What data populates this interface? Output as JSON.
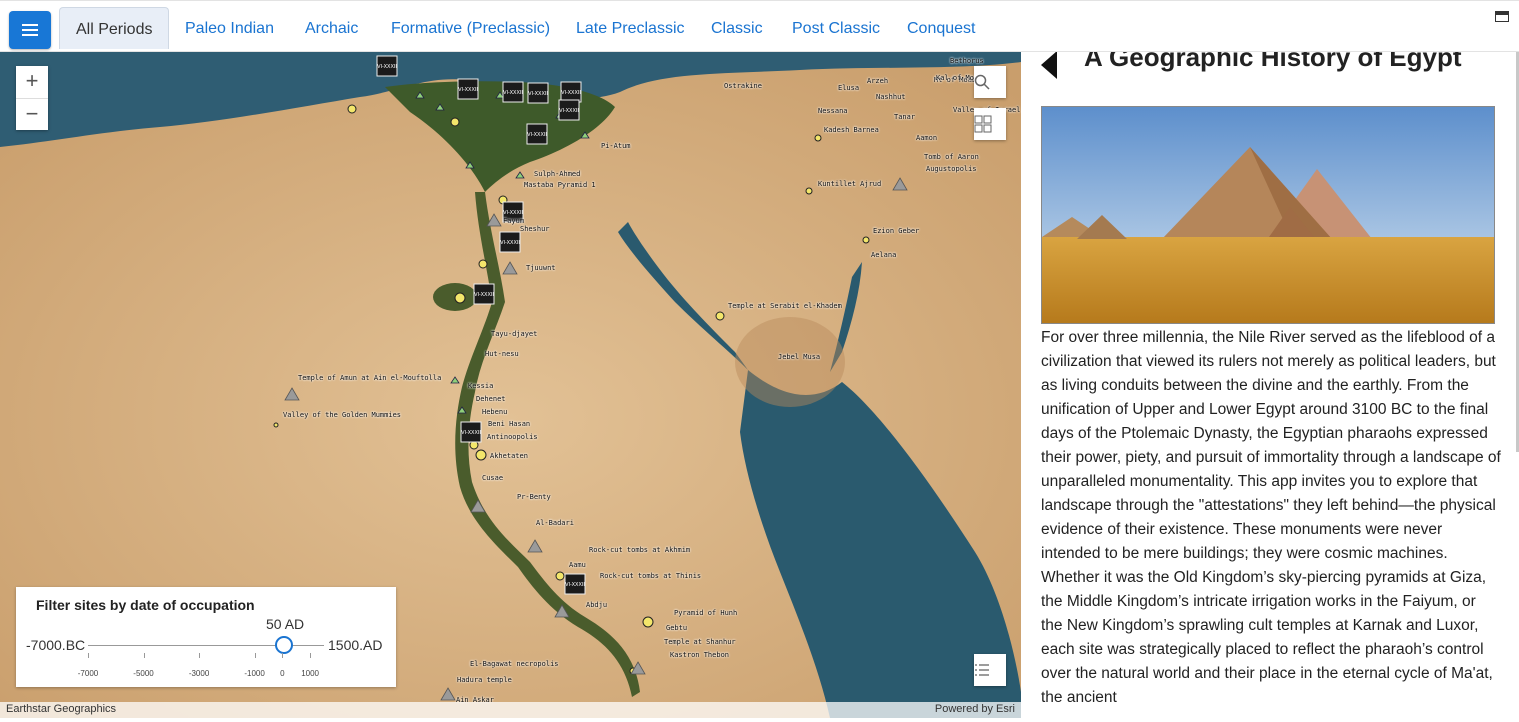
{
  "nav": {
    "tabs": [
      "All Periods",
      "Paleo Indian",
      "Archaic",
      "Formative (Preclassic)",
      "Late Preclassic",
      "Classic",
      "Post Classic",
      "Conquest"
    ],
    "active_tab": "All Periods"
  },
  "map": {
    "labels": [
      "Bethorus",
      "Arzeh",
      "Mt of Moab",
      "Ostrakine",
      "Elusa",
      "Nashhut",
      "Kal of Moab",
      "Nessana",
      "Valley of Israel",
      "Tanar",
      "Kadesh Barnea",
      "Aamon",
      "Tomb of Aaron",
      "Augustopolis",
      "Kuntillet Ajrud",
      "Ezion Geber",
      "Aelana",
      "Temple at Serabit el-Khadem",
      "Jebel Musa",
      "Pi-Atum",
      "Sulph-Ahmed",
      "Mastaba Pyramid 1",
      "Tjuuwnt",
      "Fayum",
      "Sheshur",
      "Tayu-djayet",
      "Hut-nesu",
      "Kessia",
      "Dehenet",
      "Hebenu",
      "Beni Hasan",
      "Antinoopolis",
      "Akhetaten",
      "Cusae",
      "Pr-Benty",
      "Al-Badari",
      "Rock-cut tombs at Akhmim",
      "Rock-cut tombs at Thinis",
      "Aamu",
      "Abdju",
      "Pyramid of Hunh",
      "Gebtu",
      "Temple at Shanhur",
      "Kastron Thebon",
      "Temple of Amun at Ain el-Mouftolla",
      "Valley of the Golden Mummies",
      "El-Bagawat necropolis",
      "Hadura temple",
      "Ain Askar"
    ],
    "dynasty_badges": [
      "VI-XXXII",
      "VI-XXXII",
      "VI-XXXII",
      "VI-XXXII",
      "VI-XXXII",
      "VI-XXXII",
      "VI-XXXII",
      "VI-XXXII",
      "VI-XXXII",
      "VI-XXXII",
      "VI-XXXII",
      "VI-XXXII"
    ],
    "attribution_left": "Earthstar Geographics",
    "attribution_right": "Powered by Esri"
  },
  "filter": {
    "title": "Filter sites by date of occupation",
    "current_value": "50 AD",
    "min_label": "-7000.BC",
    "max_label": "1500.AD",
    "range_min": -7000,
    "range_max": 1500,
    "value": 50,
    "ticks": [
      "-7000",
      "-5000",
      "-3000",
      "-1000",
      "0",
      "1000"
    ]
  },
  "panel": {
    "title": "A Geographic History of Egypt",
    "body": "For over three millennia, the Nile River served as the lifeblood of a civilization that viewed its rulers not merely as political leaders, but as living conduits between the divine and the earthly. From the unification of Upper and Lower Egypt around 3100 BC to the final days of the Ptolemaic Dynasty, the Egyptian pharaohs expressed their power, piety, and pursuit of immortality through a landscape of unparalleled monumentality. This app invites you to explore that landscape through the \"attestations\" they left behind—the physical evidence of their existence. These monuments were never intended to be mere buildings; they were cosmic machines. Whether it was the Old Kingdom’s sky-piercing pyramids at Giza, the Middle Kingdom’s intricate irrigation works in the Faiyum, or the New Kingdom’s sprawling cult temples at Karnak and Luxor, each site was strategically placed to reflect the pharaoh’s control over the natural world and their place in the eternal cycle of Ma'at, the ancient"
  },
  "icons": {
    "menu": "hamburger-icon",
    "window": "window-icon",
    "back": "back-arrow-icon",
    "search": "search-icon",
    "basemap": "basemap-gallery-icon",
    "legend": "legend-list-icon"
  },
  "colors": {
    "accent": "#1a74d1",
    "sea": "#2a5a6e",
    "desert": "#d9b383",
    "nile_green": "#4a5c2c"
  }
}
